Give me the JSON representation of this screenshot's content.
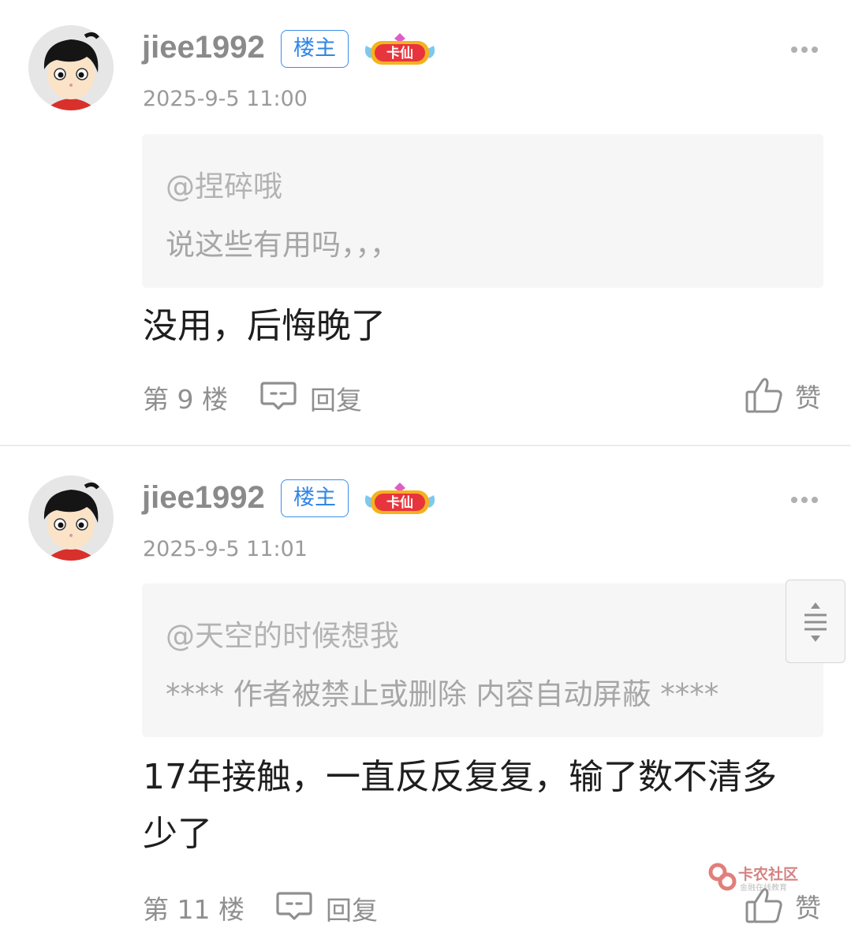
{
  "posts": [
    {
      "username": "jiee1992",
      "op_badge": "楼主",
      "rank_badge": "卡仙",
      "timestamp": "2025-9-5 11:00",
      "quote_user": "@捏碎哦",
      "quote_text": "说这些有用吗，，，",
      "content": "没用，后悔晚了",
      "floor": "第 9 楼",
      "reply_label": "回复",
      "like_label": "赞"
    },
    {
      "username": "jiee1992",
      "op_badge": "楼主",
      "rank_badge": "卡仙",
      "timestamp": "2025-9-5 11:01",
      "quote_user": "@天空的时候想我",
      "quote_text": "**** 作者被禁止或删除 内容自动屏蔽 ****",
      "content": "17年接触，一直反反复复，输了数不清多少了",
      "floor": "第 11 楼",
      "reply_label": "回复",
      "like_label": "赞"
    }
  ],
  "watermark": {
    "title": "卡农社区",
    "subtitle": "金融在线教育"
  },
  "colors": {
    "op_badge": "#2f86e6",
    "rank_badge": "#e8343c",
    "meta_text": "#8f8f8f",
    "quote_bg": "#f6f6f6"
  },
  "icons": [
    "avatar",
    "more-icon",
    "comment-icon",
    "thumbs-up-icon",
    "scroll-handle-icon",
    "logo-icon"
  ]
}
